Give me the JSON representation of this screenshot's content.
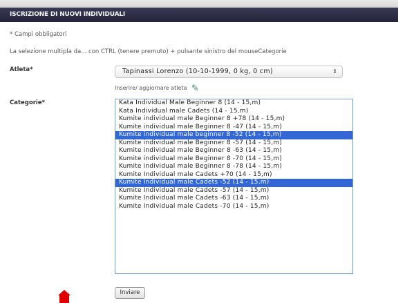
{
  "header": {
    "title": "ISCRIZIONE DI NUOVI INDIVIDUALI"
  },
  "form": {
    "required_note": "* Campi obbligatori",
    "multi_select_hint": "La selezione multipla da... con CTRL (tenere premuto) + pulsante sinistro del mouseCategorie",
    "athlete_label": "Atleta*",
    "athlete_value": "Tapinassi Lorenzo (10-10-1999, 0 kg, 0 cm)",
    "update_link": "Inserire/ aggiornare atleta",
    "category_label": "Categorie*",
    "categories": [
      {
        "label": "Kata Individual Male Beginner 8 (14 - 15,m)",
        "selected": false
      },
      {
        "label": "Kata Individual male Cadets (14 - 15,m)",
        "selected": false
      },
      {
        "label": "Kumite individual male Beginner 8 +78 (14 - 15,m)",
        "selected": false
      },
      {
        "label": "Kumite individual male Beginner 8 -47 (14 - 15,m)",
        "selected": false
      },
      {
        "label": "Kumite individual male beginner 8 -52 (14 - 15,m)",
        "selected": true
      },
      {
        "label": "Kumite individual male Beginner 8 -57 (14 - 15,m)",
        "selected": false
      },
      {
        "label": "Kumite individual male Beginner 8 -63 (14 - 15,m)",
        "selected": false
      },
      {
        "label": "Kumite individual male Beginner 8 -70 (14 - 15,m)",
        "selected": false
      },
      {
        "label": "Kumite individual male Beginner 8 -78 (14 - 15,m)",
        "selected": false
      },
      {
        "label": "Kumite Individual male Cadets +70 (14 - 15,m)",
        "selected": false
      },
      {
        "label": "Kumite Individual male Cadets -52 (14 - 15,m)",
        "selected": true
      },
      {
        "label": "Kumite Individual male Cadets -57 (14 - 15,m)",
        "selected": false
      },
      {
        "label": "Kumite Individual male Cadets -63 (14 - 15,m)",
        "selected": false
      },
      {
        "label": "Kumite Individual male Cadets -70 (14 - 15,m)",
        "selected": false
      }
    ],
    "submit_label": "Inviare"
  },
  "icons": {
    "select_arrow": "updown-arrows-icon",
    "edit": "pencil-icon",
    "marker": "home-marker-icon"
  },
  "colors": {
    "header_bg": "#2a2a44",
    "selection": "#3367d6",
    "marker": "#e00000"
  }
}
